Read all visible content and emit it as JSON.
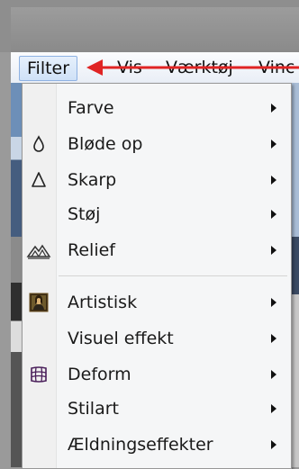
{
  "menubar": {
    "items": [
      {
        "label": "Filter"
      },
      {
        "label": "Vis"
      },
      {
        "label": "Værktøj"
      },
      {
        "label": "Vinc"
      }
    ]
  },
  "filter_menu": {
    "items": [
      {
        "label": "Farve",
        "icon": "none"
      },
      {
        "label": "Bløde op",
        "icon": "droplet-icon"
      },
      {
        "label": "Skarp",
        "icon": "triangle-icon"
      },
      {
        "label": "Støj",
        "icon": "none"
      },
      {
        "label": "Relief",
        "icon": "mountain-emboss-icon"
      },
      {
        "label": "Artistisk",
        "icon": "mona-lisa-icon"
      },
      {
        "label": "Visuel effekt",
        "icon": "none"
      },
      {
        "label": "Deform",
        "icon": "grid-warp-icon"
      },
      {
        "label": "Stilart",
        "icon": "none"
      },
      {
        "label": "Ældningseffekter",
        "icon": "none"
      }
    ]
  },
  "colors": {
    "annotation_arrow": "#e02424",
    "menu_highlight": "#cfe1f7"
  }
}
